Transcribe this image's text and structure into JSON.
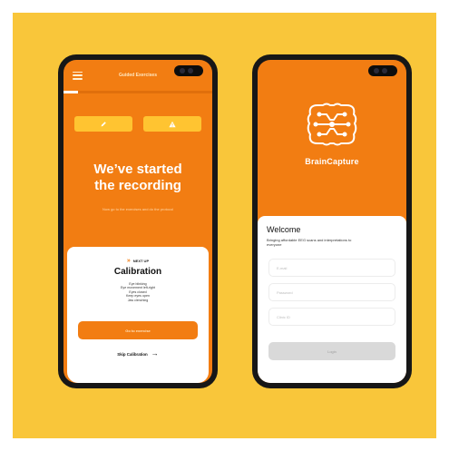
{
  "left_phone": {
    "topbar_title": "Guided Exercises",
    "progress_percent": 10,
    "action_buttons": [
      {
        "icon": "pencil-icon"
      },
      {
        "icon": "warning-icon"
      }
    ],
    "headline_line1": "We’ve started",
    "headline_line2": "the recording",
    "subtext": "Now go to the exercises and do the protocol",
    "card": {
      "next_up_label": "NEXT UP",
      "title": "Calibration",
      "steps": [
        "Eye blinking",
        "Eye movement left-right",
        "Eyes closed",
        "Keep eyes open",
        "Jaw clenching"
      ],
      "primary_button": "Go to exercise",
      "skip_label": "Skip Calibration"
    }
  },
  "right_phone": {
    "brand": "BrainCapture",
    "welcome": "Welcome",
    "tagline": "Bringing affordable EEG scans and interpretations to everyone",
    "fields": {
      "email_placeholder": "E-mail",
      "password_placeholder": "Password",
      "clinic_placeholder": "Clinic ID"
    },
    "login_label": "Login"
  },
  "colors": {
    "background": "#f9c63a",
    "accent": "#f27d12",
    "button_yellow": "#ffc431",
    "disabled": "#d9d9d9"
  }
}
